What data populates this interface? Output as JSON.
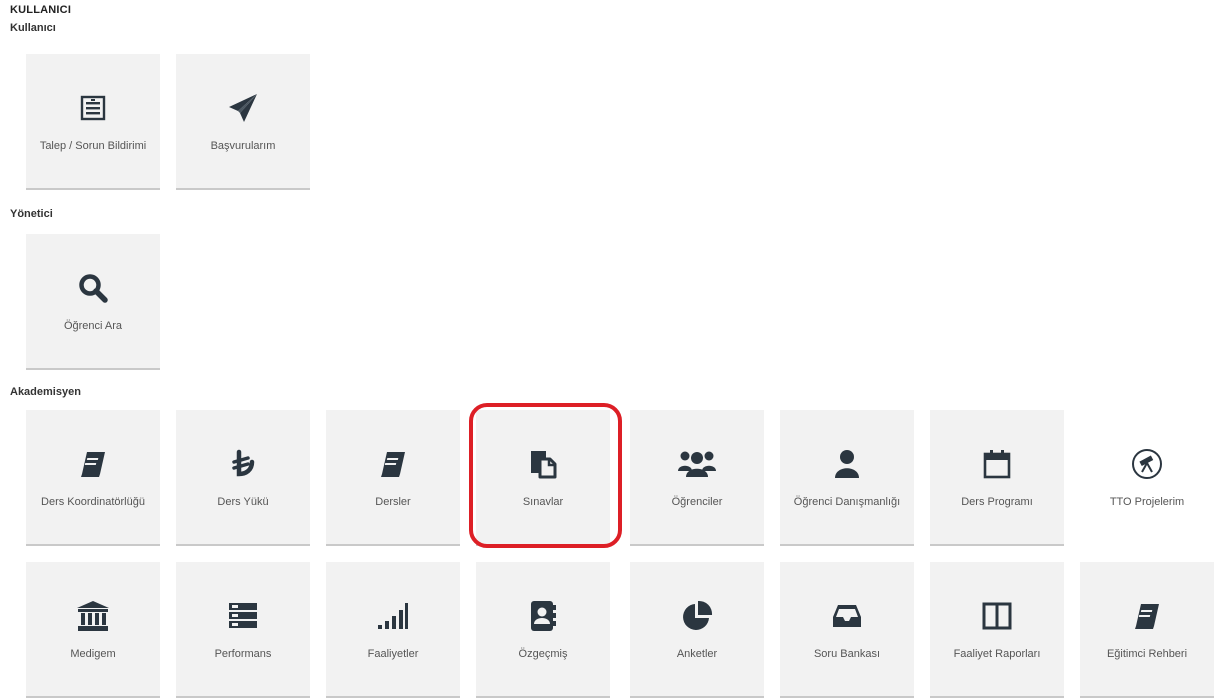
{
  "page": {
    "title": "KULLANICI"
  },
  "sections": {
    "kullanici": {
      "title": "Kullanıcı",
      "tiles": [
        {
          "label": "Talep / Sorun Bildirimi",
          "icon": "request-list-icon"
        },
        {
          "label": "Başvurularım",
          "icon": "paper-plane-icon"
        }
      ]
    },
    "yonetici": {
      "title": "Yönetici",
      "tiles": [
        {
          "label": "Öğrenci Ara",
          "icon": "search-icon"
        }
      ]
    },
    "akademisyen": {
      "title": "Akademisyen",
      "tiles": [
        {
          "label": "Ders Koordinatörlüğü",
          "icon": "book-icon"
        },
        {
          "label": "Ders Yükü",
          "icon": "turkish-lira-icon"
        },
        {
          "label": "Dersler",
          "icon": "book-icon"
        },
        {
          "label": "Sınavlar",
          "icon": "documents-icon"
        },
        {
          "label": "Öğrenciler",
          "icon": "users-icon"
        },
        {
          "label": "Öğrenci Danışmanlığı",
          "icon": "user-icon"
        },
        {
          "label": "Ders Programı",
          "icon": "calendar-icon"
        },
        {
          "label": "TTO Projelerim",
          "icon": "telescope-icon"
        },
        {
          "label": "Medigem",
          "icon": "institution-icon"
        },
        {
          "label": "Performans",
          "icon": "server-icon"
        },
        {
          "label": "Faaliyetler",
          "icon": "signal-bars-icon"
        },
        {
          "label": "Özgeçmiş",
          "icon": "address-book-icon"
        },
        {
          "label": "Anketler",
          "icon": "pie-chart-icon"
        },
        {
          "label": "Soru Bankası",
          "icon": "inbox-icon"
        },
        {
          "label": "Faaliyet Raporları",
          "icon": "columns-icon"
        },
        {
          "label": "Eğitimci Rehberi",
          "icon": "book-icon"
        }
      ]
    }
  },
  "highlight": {
    "target": "Sınavlar",
    "color": "#dd1f26"
  },
  "colors": {
    "icon": "#2b3640",
    "tile_bg": "#f2f2f2",
    "text": "#555555"
  }
}
